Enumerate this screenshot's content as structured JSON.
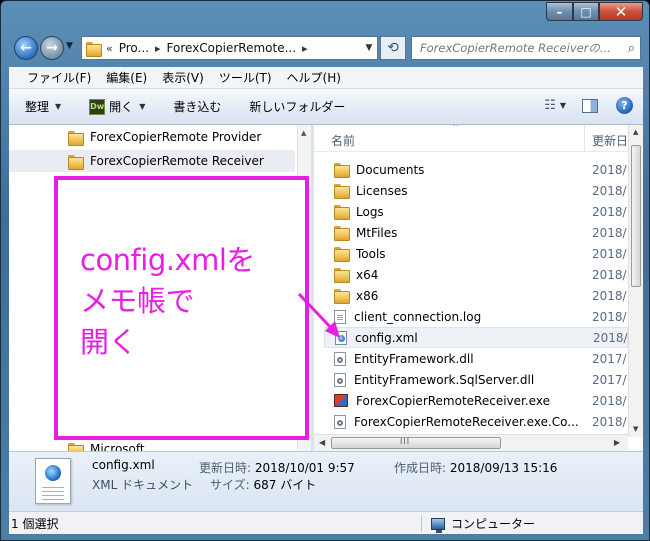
{
  "window": {
    "title_buttons": {
      "minimize": "–",
      "maximize": "□",
      "close": "✕"
    }
  },
  "address_bar": {
    "overflow": "«",
    "crumbs": [
      "Pro...",
      "ForexCopierRemote..."
    ],
    "search_placeholder": "ForexCopierRemote Receiverの..."
  },
  "menu": [
    "ファイル(F)",
    "編集(E)",
    "表示(V)",
    "ツール(T)",
    "ヘルプ(H)"
  ],
  "toolbar": {
    "organize": "整理",
    "open": "開く",
    "open_app_badge": "Dw",
    "burn": "書き込む",
    "new_folder": "新しいフォルダー"
  },
  "nav_pane": {
    "items": [
      {
        "label": "ForexCopierRemote Provider",
        "selected": false
      },
      {
        "label": "ForexCopierRemote Receiver",
        "selected": true
      },
      {
        "label": "Microsoft",
        "selected": false
      }
    ]
  },
  "file_list": {
    "columns": {
      "name": "名前",
      "date": "更新日"
    },
    "rows": [
      {
        "name": "Documents",
        "date": "2018/",
        "icon": "folder-icon"
      },
      {
        "name": "Licenses",
        "date": "2018/",
        "icon": "folder-icon"
      },
      {
        "name": "Logs",
        "date": "2018/",
        "icon": "folder-icon"
      },
      {
        "name": "MtFiles",
        "date": "2018/",
        "icon": "folder-icon"
      },
      {
        "name": "Tools",
        "date": "2018/",
        "icon": "folder-icon"
      },
      {
        "name": "x64",
        "date": "2018/",
        "icon": "folder-icon"
      },
      {
        "name": "x86",
        "date": "2018/",
        "icon": "folder-icon"
      },
      {
        "name": "client_connection.log",
        "date": "2018/",
        "icon": "document-icon"
      },
      {
        "name": "config.xml",
        "date": "2018/",
        "icon": "xml-file-icon",
        "selected": true
      },
      {
        "name": "EntityFramework.dll",
        "date": "2017/",
        "icon": "dll-file-icon"
      },
      {
        "name": "EntityFramework.SqlServer.dll",
        "date": "2017/",
        "icon": "dll-file-icon"
      },
      {
        "name": "ForexCopierRemoteReceiver.exe",
        "date": "2018/",
        "icon": "exe-file-icon"
      },
      {
        "name": "ForexCopierRemoteReceiver.exe.Co...",
        "date": "2018/",
        "icon": "config-file-icon"
      }
    ],
    "hscroll_grip": "III"
  },
  "details": {
    "name": "config.xml",
    "type": "XML ドキュメント",
    "modified_label": "更新日時:",
    "modified_value": "2018/10/01 9:57",
    "created_label": "作成日時:",
    "created_value": "2018/09/13 15:16",
    "size_label": "サイズ:",
    "size_value": "687 バイト"
  },
  "status": {
    "selected_count": "1 個選択",
    "location": "コンピューター"
  },
  "annotation": {
    "text": "config.xmlを\nメモ帳で\n開く",
    "color": "#e81ee4"
  }
}
